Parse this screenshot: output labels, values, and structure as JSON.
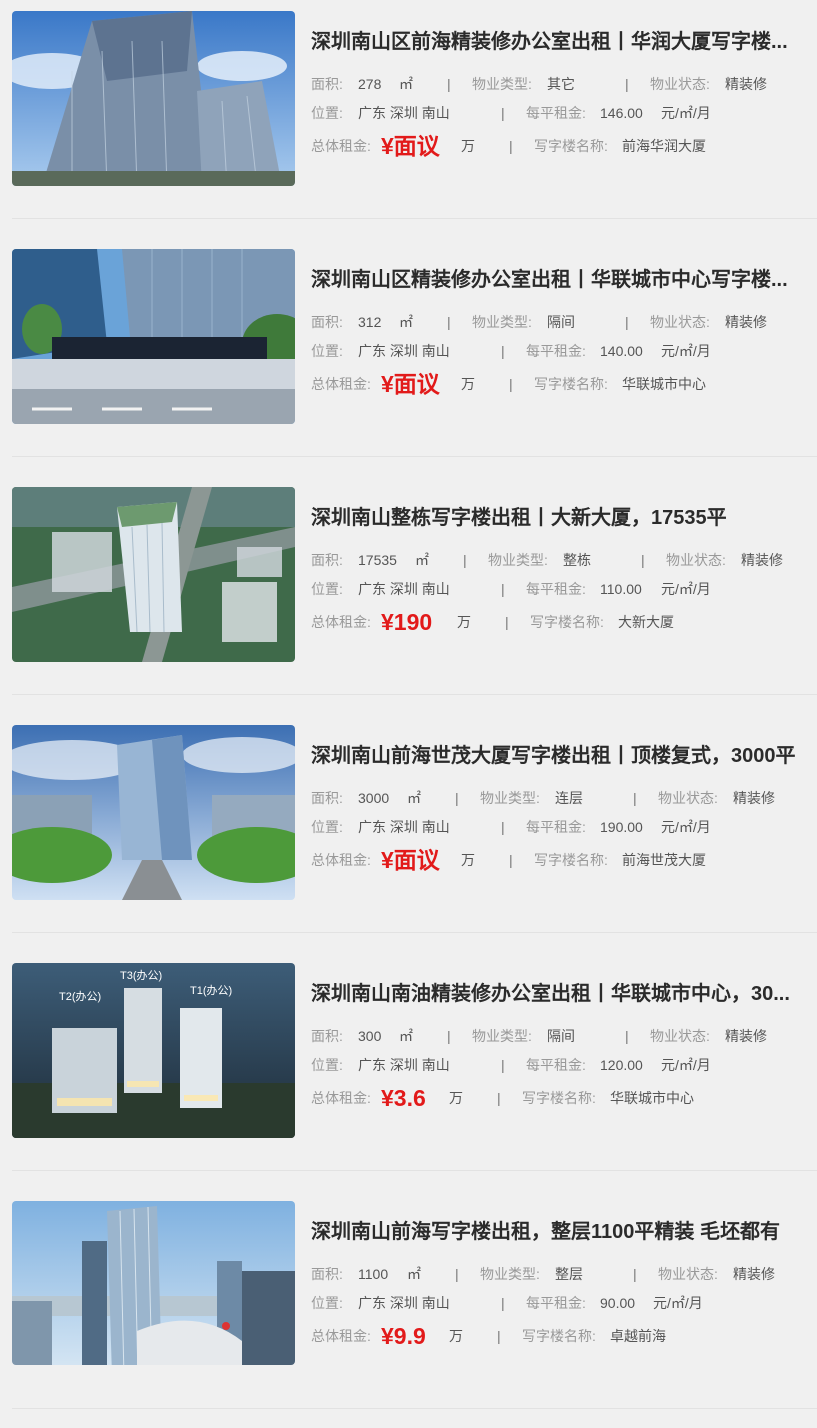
{
  "listings": [
    {
      "title": "深圳南山区前海精装修办公室出租丨华润大厦写字楼...",
      "area_label": "面积:",
      "area": "278",
      "area_unit": "㎡",
      "type_label": "物业类型:",
      "type": "其它",
      "status_label": "物业状态:",
      "status": "精装修",
      "loc_label": "位置:",
      "location": "广东 深圳 南山",
      "unit_price_label": "每平租金:",
      "unit_price": "146.00",
      "unit_price_unit": "元/㎡/月",
      "total_label": "总体租金:",
      "total": "¥面议",
      "total_unit": "万",
      "name_label": "写字楼名称:",
      "name": "前海华润大厦",
      "image": "office-tower-photo"
    },
    {
      "title": "深圳南山区精装修办公室出租丨华联城市中心写字楼...",
      "area_label": "面积:",
      "area": "312",
      "area_unit": "㎡",
      "type_label": "物业类型:",
      "type": "隔间",
      "status_label": "物业状态:",
      "status": "精装修",
      "loc_label": "位置:",
      "location": "广东 深圳 南山",
      "unit_price_label": "每平租金:",
      "unit_price": "140.00",
      "unit_price_unit": "元/㎡/月",
      "total_label": "总体租金:",
      "total": "¥面议",
      "total_unit": "万",
      "name_label": "写字楼名称:",
      "name": "华联城市中心",
      "image": "office-entrance-photo"
    },
    {
      "title": "深圳南山整栋写字楼出租丨大新大厦，17535平",
      "area_label": "面积:",
      "area": "17535",
      "area_unit": "㎡",
      "type_label": "物业类型:",
      "type": "整栋",
      "status_label": "物业状态:",
      "status": "精装修",
      "loc_label": "位置:",
      "location": "广东 深圳 南山",
      "unit_price_label": "每平租金:",
      "unit_price": "110.00",
      "unit_price_unit": "元/㎡/月",
      "total_label": "总体租金:",
      "total": "¥190",
      "total_unit": "万",
      "name_label": "写字楼名称:",
      "name": "大新大厦",
      "image": "aerial-rendering-photo"
    },
    {
      "title": "深圳南山前海世茂大厦写字楼出租丨顶楼复式，3000平",
      "area_label": "面积:",
      "area": "3000",
      "area_unit": "㎡",
      "type_label": "物业类型:",
      "type": "连层",
      "status_label": "物业状态:",
      "status": "精装修",
      "loc_label": "位置:",
      "location": "广东 深圳 南山",
      "unit_price_label": "每平租金:",
      "unit_price": "190.00",
      "unit_price_unit": "元/㎡/月",
      "total_label": "总体租金:",
      "total": "¥面议",
      "total_unit": "万",
      "name_label": "写字楼名称:",
      "name": "前海世茂大厦",
      "image": "glass-tower-photo"
    },
    {
      "title": "深圳南山南油精装修办公室出租丨华联城市中心，30...",
      "area_label": "面积:",
      "area": "300",
      "area_unit": "㎡",
      "type_label": "物业类型:",
      "type": "隔间",
      "status_label": "物业状态:",
      "status": "精装修",
      "loc_label": "位置:",
      "location": "广东 深圳 南山",
      "unit_price_label": "每平租金:",
      "unit_price": "120.00",
      "unit_price_unit": "元/㎡/月",
      "total_label": "总体租金:",
      "total": "¥3.6",
      "total_unit": "万",
      "name_label": "写字楼名称:",
      "name": "华联城市中心",
      "image": "night-towers-rendering",
      "image_labels": [
        "T2(办公)",
        "T3(办公)",
        "T1(办公)"
      ]
    },
    {
      "title": "深圳南山前海写字楼出租，整层1100平精装 毛坯都有",
      "area_label": "面积:",
      "area": "1100",
      "area_unit": "㎡",
      "type_label": "物业类型:",
      "type": "整层",
      "status_label": "物业状态:",
      "status": "精装修",
      "loc_label": "位置:",
      "location": "广东 深圳 南山",
      "unit_price_label": "每平租金:",
      "unit_price": "90.00",
      "unit_price_unit": "元/㎡/月",
      "total_label": "总体租金:",
      "total": "¥9.9",
      "total_unit": "万",
      "name_label": "写字楼名称:",
      "name": "卓越前海",
      "image": "bay-skyline-photo"
    }
  ],
  "colors": {
    "price": "#e21a1a",
    "background": "#f0f0f0",
    "title": "#2b2b2b"
  }
}
